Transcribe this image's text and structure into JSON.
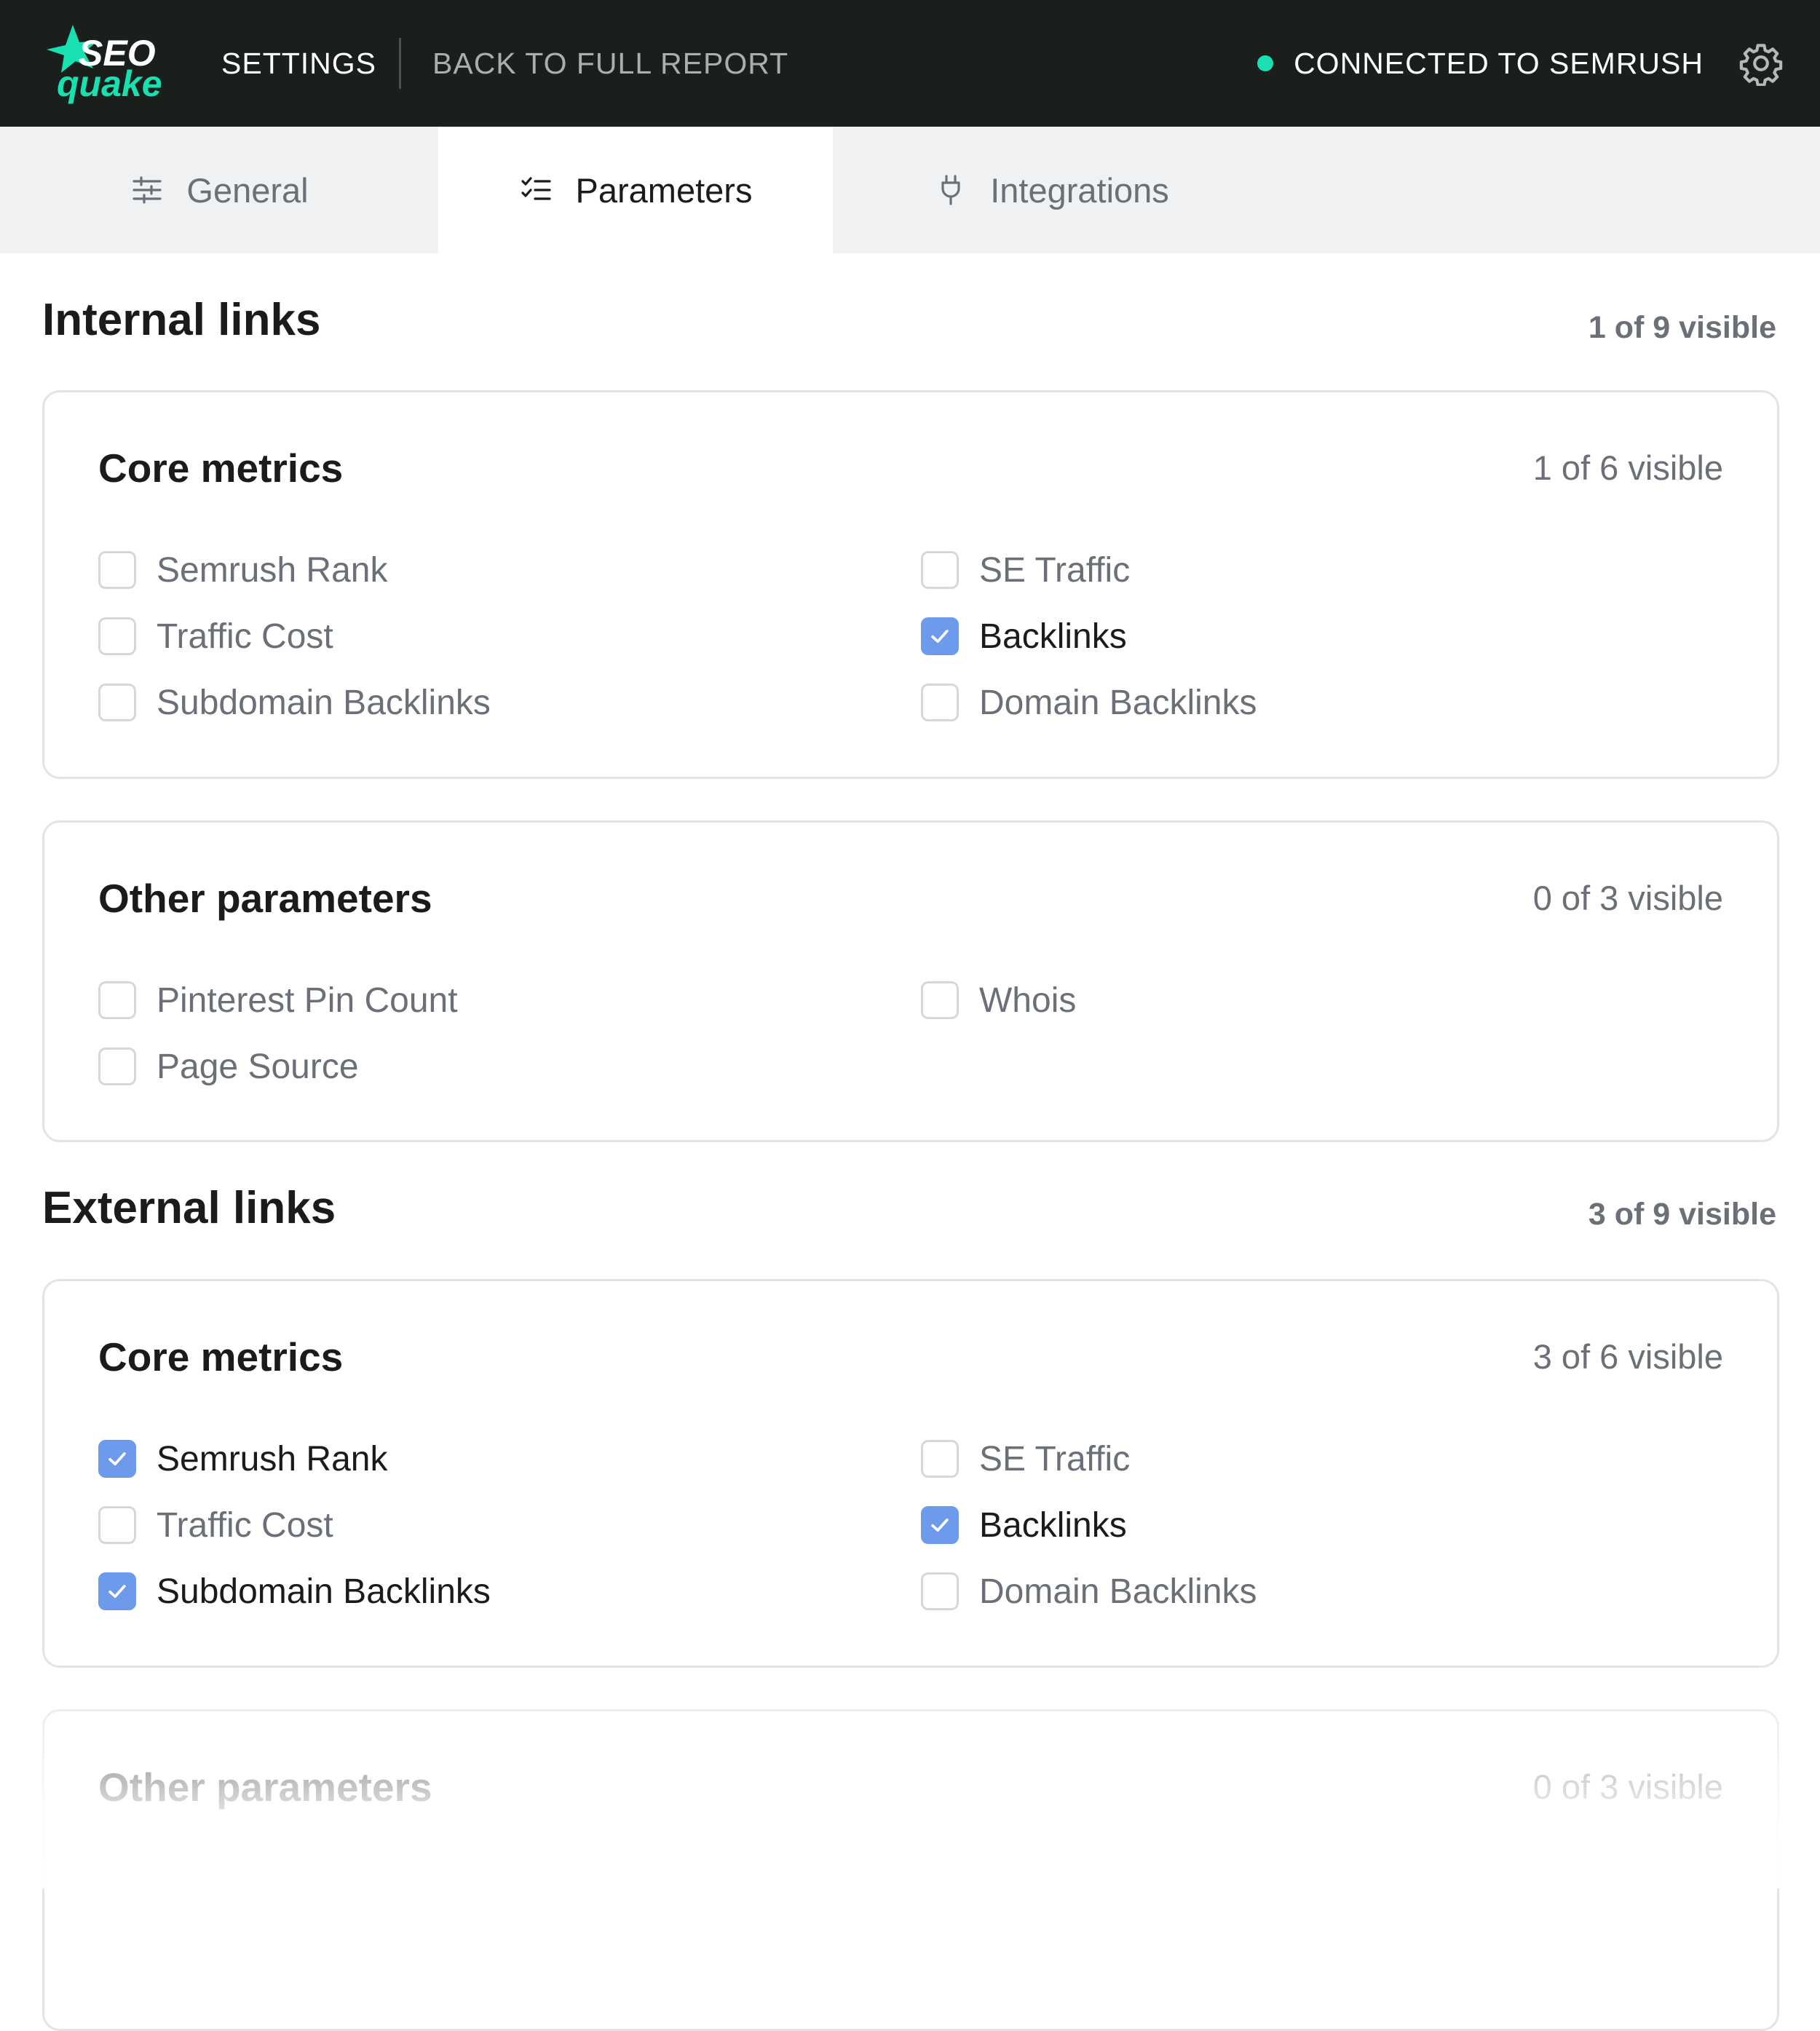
{
  "header": {
    "logo_text_top": "SEO",
    "logo_text_bottom": "quake",
    "settings_label": "SETTINGS",
    "back_label": "BACK TO FULL REPORT",
    "connected_label": "CONNECTED TO SEMRUSH",
    "icons": {
      "status": "status-dot-icon",
      "gear": "gear-icon"
    },
    "colors": {
      "bar_bg": "#1b1f1c",
      "accent": "#18e0b0"
    }
  },
  "tabs": [
    {
      "label": "General",
      "icon": "sliders-icon",
      "active": false
    },
    {
      "label": "Parameters",
      "icon": "checklist-icon",
      "active": true
    },
    {
      "label": "Integrations",
      "icon": "plug-icon",
      "active": false
    }
  ],
  "internal": {
    "title": "Internal links",
    "count": "1 of 9 visible",
    "core": {
      "title": "Core metrics",
      "count": "1 of 6 visible",
      "items": [
        {
          "label": "Semrush Rank",
          "checked": false
        },
        {
          "label": "SE Traffic",
          "checked": false
        },
        {
          "label": "Traffic Cost",
          "checked": false
        },
        {
          "label": "Backlinks",
          "checked": true
        },
        {
          "label": "Subdomain Backlinks",
          "checked": false
        },
        {
          "label": "Domain Backlinks",
          "checked": false
        }
      ]
    },
    "other": {
      "title": "Other parameters",
      "count": "0 of 3 visible",
      "items": [
        {
          "label": "Pinterest Pin Count",
          "checked": false
        },
        {
          "label": "Whois",
          "checked": false
        },
        {
          "label": "Page Source",
          "checked": false
        }
      ]
    }
  },
  "external": {
    "title": "External links",
    "count": "3 of 9 visible",
    "core": {
      "title": "Core metrics",
      "count": "3 of 6 visible",
      "items": [
        {
          "label": "Semrush Rank",
          "checked": true
        },
        {
          "label": "SE Traffic",
          "checked": false
        },
        {
          "label": "Traffic Cost",
          "checked": false
        },
        {
          "label": "Backlinks",
          "checked": true
        },
        {
          "label": "Subdomain Backlinks",
          "checked": true
        },
        {
          "label": "Domain Backlinks",
          "checked": false
        }
      ]
    },
    "other": {
      "title": "Other parameters",
      "count": "0 of 3 visible"
    }
  },
  "colors": {
    "checkbox_checked": "#6e9aec",
    "muted_text": "#6b7078"
  }
}
